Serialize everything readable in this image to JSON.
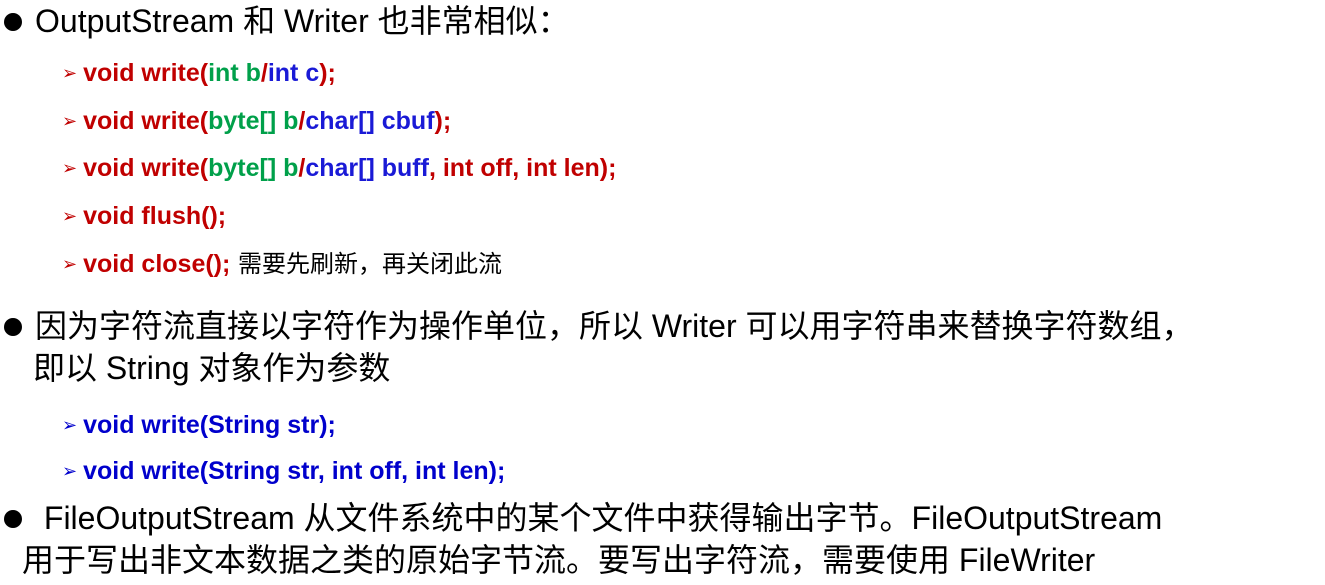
{
  "bullet1": {
    "text": "OutputStream 和 Writer 也非常相似："
  },
  "sub1": [
    {
      "t1": "void write(",
      "t2": "int b",
      "t3": "/",
      "t4": "int c",
      "t5": ");"
    },
    {
      "t1": "void write(",
      "t2": "byte[] b",
      "t3": "/",
      "t4": "char[] cbuf",
      "t5": ");"
    },
    {
      "t1": "void write(",
      "t2": "byte[] b",
      "t3": "/",
      "t4": "char[] buff",
      "t5": ", int off, int len);"
    },
    {
      "t1": "void flush();"
    },
    {
      "t1": "void close();",
      "note": " 需要先刷新，再关闭此流"
    }
  ],
  "bullet2": {
    "line1": "因为字符流直接以字符作为操作单位，所以 Writer 可以用字符串来替换字符数组，",
    "line2": "即以 String 对象作为参数"
  },
  "sub2": [
    {
      "t1": "void write(String str);"
    },
    {
      "t1": "void write(String str, int off, int len);"
    }
  ],
  "bullet3": {
    "line1": " FileOutputStream 从文件系统中的某个文件中获得输出字节。FileOutputStream",
    "line2": "用于写出非文本数据之类的原始字节流。要写出字符流，需要使用 FileWriter"
  },
  "colors": {
    "red": "#c00000",
    "green": "#00a04a",
    "blue": "#1a1ad6",
    "bullet": "#000000"
  },
  "icons": {
    "bullet": "filled-circle",
    "sub_bullet": "arrowhead-right"
  }
}
